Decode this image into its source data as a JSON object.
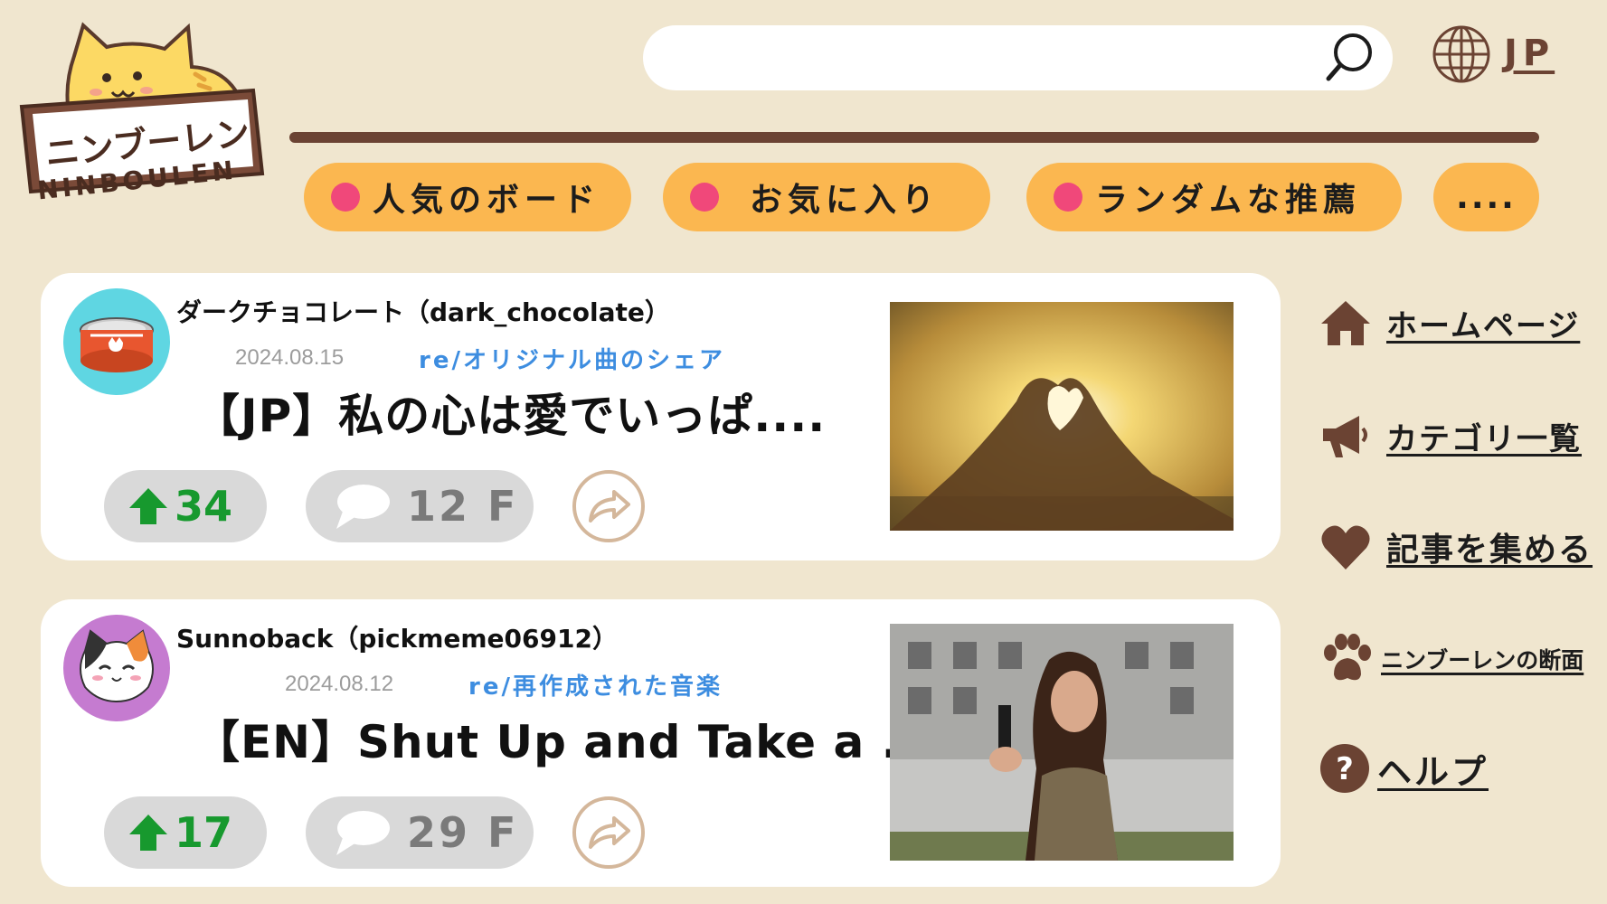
{
  "brand": {
    "logo_text_jp": "ニンブーレン",
    "logo_text_en": "NINBOULEN"
  },
  "header": {
    "search_value": "",
    "language_label": "JP"
  },
  "tabs": [
    {
      "label": "人気のボード"
    },
    {
      "label": "お気に入り"
    },
    {
      "label": "ランダムな推薦"
    },
    {
      "label": "...."
    }
  ],
  "posts": [
    {
      "author": "ダークチョコレート（dark_chocolate）",
      "date": "2024.08.15",
      "board": "re/オリジナル曲のシェア",
      "title": "【JP】私の心は愛でいっぱ....",
      "upvotes": "34",
      "comments": "12 F",
      "avatar_icon": "canned-food-icon",
      "image": "heart-hands-sunset-photo"
    },
    {
      "author": "Sunnoback（pickmeme06912）",
      "date": "2024.08.12",
      "board": "re/再作成された音楽",
      "title": "【EN】Shut Up and Take a ....",
      "upvotes": "17",
      "comments": "29 F",
      "avatar_icon": "calico-cat-icon",
      "image": "woman-with-gun-photo"
    }
  ],
  "sidebar": {
    "items": [
      {
        "label": "ホームページ",
        "icon": "home-icon"
      },
      {
        "label": "カテゴリ一覧",
        "icon": "megaphone-icon"
      },
      {
        "label": "記事を集める",
        "icon": "heart-icon"
      },
      {
        "label": "ニンブーレンの断面",
        "icon": "paw-icon"
      },
      {
        "label": "ヘルプ",
        "icon": "help-icon"
      }
    ]
  },
  "colors": {
    "background": "#f0e6cf",
    "accent_brown": "#6b4333",
    "tab_orange": "#fbb750",
    "tab_dot_pink": "#f0487a",
    "upvote_green": "#17992e",
    "board_blue": "#3d8de0"
  }
}
